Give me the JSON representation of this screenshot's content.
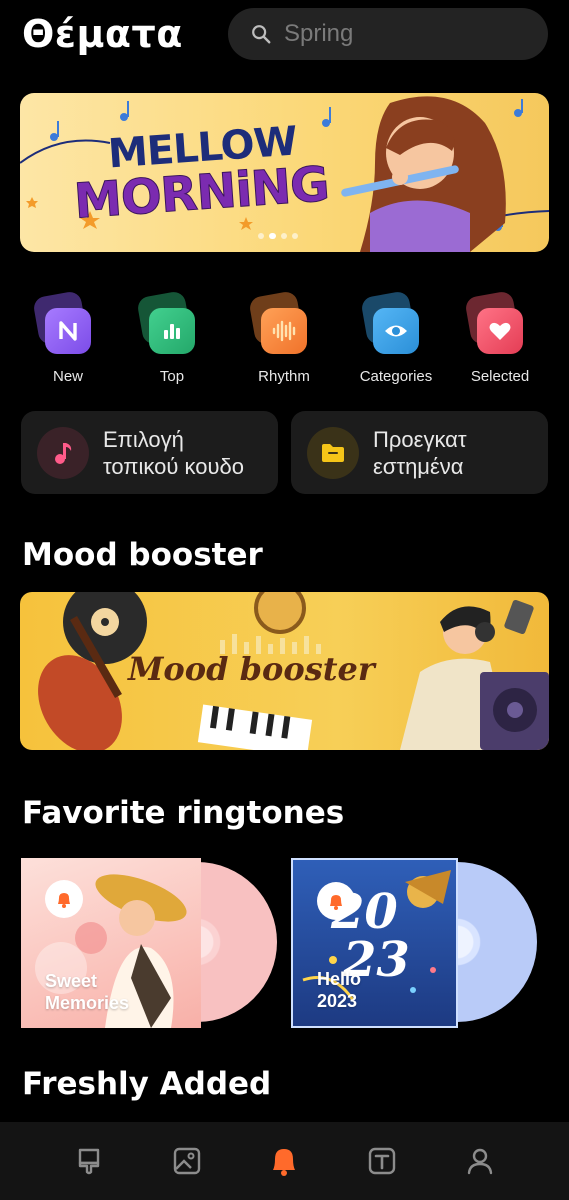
{
  "header": {
    "title": "Θέματα",
    "search_placeholder": "Spring"
  },
  "hero": {
    "line1": "MELLOW",
    "line2": "MORNiNG",
    "page_count": 4,
    "active_page": 2
  },
  "categories": [
    {
      "label": "New",
      "icon": "new-icon",
      "color": "#8b5cf6"
    },
    {
      "label": "Top",
      "icon": "chart-icon",
      "color": "#2fbf7a"
    },
    {
      "label": "Rhythm",
      "icon": "waveform-icon",
      "color": "#f7893a"
    },
    {
      "label": "Categories",
      "icon": "eye-icon",
      "color": "#3aa2e8"
    },
    {
      "label": "Selected",
      "icon": "heart-icon",
      "color": "#f0566a"
    }
  ],
  "quick": [
    {
      "label": "Επιλογή τοπικού κουδο",
      "icon": "music-note-icon"
    },
    {
      "label": "Προεγκατ εστημένα",
      "icon": "folder-icon"
    }
  ],
  "sections": {
    "mood_booster": "Mood booster",
    "favorites": "Favorite ringtones",
    "fresh": "Freshly Added"
  },
  "mood_banner_text": "Mood booster",
  "ringtones": [
    {
      "title": "Sweet Memories",
      "color": "#f7a8a2"
    },
    {
      "title": "Hello 2023",
      "color": "#1f3f86"
    }
  ],
  "nav": [
    {
      "icon": "brush-icon",
      "active": false
    },
    {
      "icon": "wallpaper-icon",
      "active": false
    },
    {
      "icon": "bell-icon",
      "active": true
    },
    {
      "icon": "font-icon",
      "active": false
    },
    {
      "icon": "profile-icon",
      "active": false
    }
  ],
  "colors": {
    "accent": "#ff6a2b",
    "background": "#000000"
  }
}
